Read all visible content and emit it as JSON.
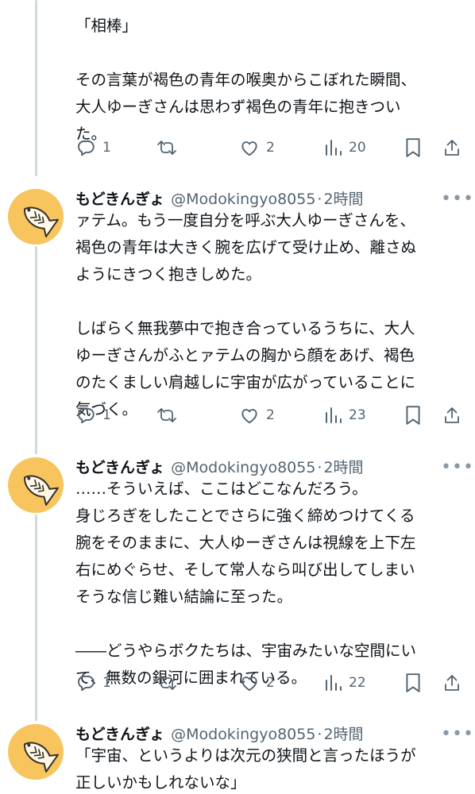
{
  "tweets": [
    {
      "lines": [
        "「相棒」",
        "",
        "その言葉が褐色の青年の喉奥からこぼれた瞬間、",
        "大人ゆーぎさんは思わず褐色の青年に抱きつい",
        "た。"
      ],
      "replies": "1",
      "likes": "2",
      "views": "20"
    },
    {
      "name": "もどきんぎょ",
      "handle": "@Modokingyo8055",
      "time": "2時間",
      "lines": [
        "ァテム。もう一度自分を呼ぶ大人ゆーぎさんを、",
        "褐色の青年は大きく腕を広げて受け止め、離さぬ",
        "ようにきつく抱きしめた。",
        "",
        "しばらく無我夢中で抱き合っているうちに、大人",
        "ゆーぎさんがふとァテムの胸から顔をあげ、褐色",
        "のたくましい肩越しに宇宙が広がっていることに",
        "気づく。"
      ],
      "replies": "1",
      "likes": "2",
      "views": "23"
    },
    {
      "name": "もどきんぎょ",
      "handle": "@Modokingyo8055",
      "time": "2時間",
      "lines": [
        "……そういえば、ここはどこなんだろう。",
        "身じろぎをしたことでさらに強く締めつけてくる",
        "腕をそのままに、大人ゆーぎさんは視線を上下左",
        "右にめぐらせ、そして常人なら叫び出してしまい",
        "そうな信じ難い結論に至った。",
        "",
        "――どうやらボクたちは、宇宙みたいな空間にい",
        "て、無数の銀河に囲まれている。"
      ],
      "replies": "1",
      "likes": "2",
      "views": "22"
    },
    {
      "name": "もどきんぎょ",
      "handle": "@Modokingyo8055",
      "time": "2時間",
      "lines": [
        "「宇宙、というよりは次元の狭間と言ったほうが",
        "正しいかもしれないな」"
      ]
    }
  ],
  "separator": "·",
  "more_glyph": "•••",
  "icons": [
    "reply-icon",
    "retweet-icon",
    "like-icon",
    "views-icon",
    "bookmark-icon",
    "share-icon",
    "more-icon",
    "fish-avatar"
  ],
  "colors": {
    "text": "#0f1419",
    "secondary": "#536471",
    "avatar_bg": "#f7c45d",
    "thread_line": "#cfd9de"
  }
}
